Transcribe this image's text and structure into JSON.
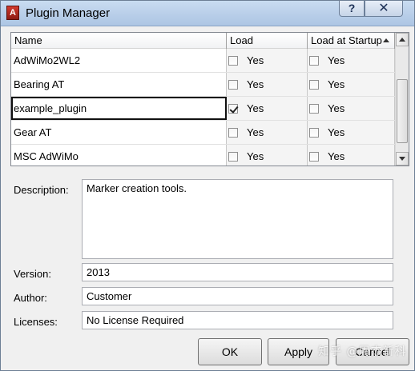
{
  "window": {
    "title": "Plugin Manager",
    "app_icon_letter": "A",
    "help_glyph": "?",
    "close_glyph": "✕"
  },
  "table": {
    "headers": {
      "name": "Name",
      "load": "Load",
      "startup": "Load at Startup"
    },
    "rows": [
      {
        "name": "AdWiMo2WL2",
        "load_checked": false,
        "load_label": "Yes",
        "startup_checked": false,
        "startup_label": "Yes"
      },
      {
        "name": "Bearing AT",
        "load_checked": false,
        "load_label": "Yes",
        "startup_checked": false,
        "startup_label": "Yes"
      },
      {
        "name": "example_plugin",
        "load_checked": true,
        "load_label": "Yes",
        "startup_checked": false,
        "startup_label": "Yes"
      },
      {
        "name": "Gear AT",
        "load_checked": false,
        "load_label": "Yes",
        "startup_checked": false,
        "startup_label": "Yes"
      },
      {
        "name": "MSC AdWiMo",
        "load_checked": false,
        "load_label": "Yes",
        "startup_checked": false,
        "startup_label": "Yes"
      }
    ],
    "selected_row": 2
  },
  "details": {
    "description_label": "Description:",
    "description_value": "Marker creation tools.",
    "version_label": "Version:",
    "version_value": "2013",
    "author_label": "Author:",
    "author_value": "Customer",
    "licenses_label": "Licenses:",
    "licenses_value": "No License Required"
  },
  "buttons": {
    "ok": "OK",
    "apply": "Apply",
    "cancel": "Cancel"
  },
  "watermark": "知乎 @周杰新科"
}
